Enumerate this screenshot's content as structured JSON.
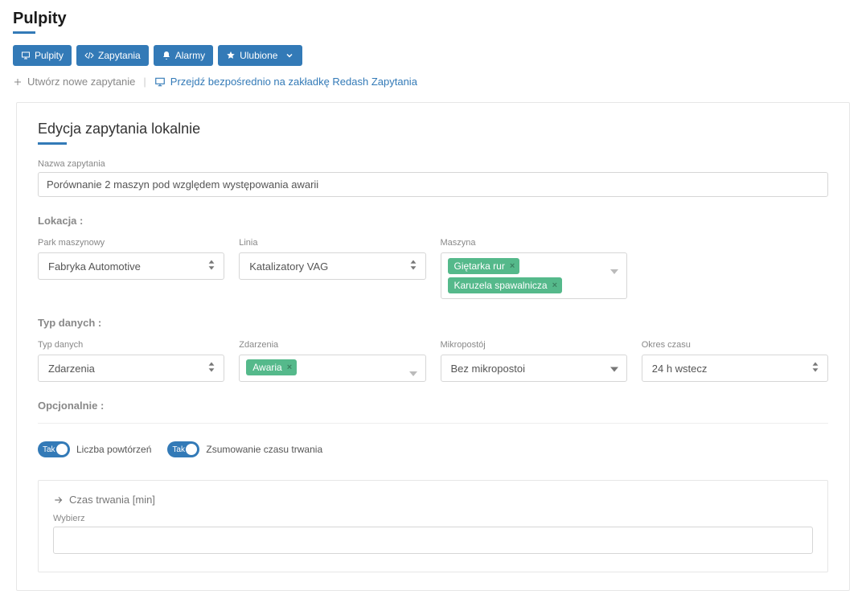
{
  "page": {
    "title": "Pulpity"
  },
  "nav": {
    "pulpity": "Pulpity",
    "zapytania": "Zapytania",
    "alarmy": "Alarmy",
    "ulubione": "Ulubione"
  },
  "actions": {
    "create": "Utwórz nowe zapytanie",
    "redash": "Przejdź bezpośrednio na zakładkę Redash Zapytania"
  },
  "panel": {
    "title": "Edycja zapytania lokalnie",
    "name_label": "Nazwa zapytania",
    "name_value": "Porównanie 2 maszyn pod względem występowania awarii",
    "location": {
      "heading": "Lokacja :",
      "park_label": "Park maszynowy",
      "park_value": "Fabryka Automotive",
      "line_label": "Linia",
      "line_value": "Katalizatory VAG",
      "machine_label": "Maszyna",
      "machine_tags": [
        "Giętarka rur",
        "Karuzela spawalnicza"
      ]
    },
    "datatype": {
      "heading": "Typ danych :",
      "type_label": "Typ danych",
      "type_value": "Zdarzenia",
      "events_label": "Zdarzenia",
      "events_tags": [
        "Awaria"
      ],
      "micro_label": "Mikropostój",
      "micro_value": "Bez mikropostoi",
      "period_label": "Okres czasu",
      "period_value": "24 h wstecz"
    },
    "optional": {
      "heading": "Opcjonalnie :",
      "switch_on": "Tak",
      "repeat_label": "Liczba powtórzeń",
      "sum_label": "Zsumowanie czasu trwania"
    },
    "duration": {
      "heading": "Czas trwania [min]",
      "select_label": "Wybierz"
    }
  }
}
